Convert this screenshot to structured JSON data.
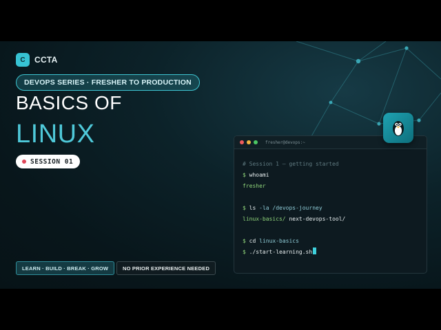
{
  "brand": {
    "logo_letter": "C",
    "name": "CCTA"
  },
  "series_pill": "DEVOPS SERIES · FRESHER TO PRODUCTION",
  "title": {
    "line1": "BASICS OF",
    "line2": "LINUX"
  },
  "session": "SESSION 01",
  "tags": {
    "learn": "LEARN · BUILD · BREAK · GROW",
    "prior": "NO PRIOR EXPERIENCE NEEDED"
  },
  "terminal": {
    "title": "fresher@devops:~",
    "comment": "# Session 1 — getting started",
    "prompt": "$",
    "cmd_whoami": "whoami",
    "out_whoami": "fresher",
    "cmd_ls": "ls",
    "cmd_ls_args": "-la /devops-journey",
    "out_ls_dir": "linux-basics/",
    "out_ls_plain": "next-devops-tool/",
    "cmd_cd": "cd",
    "cmd_cd_arg": "linux-basics",
    "cmd_run": "./start-learning.sh"
  },
  "badge_icon": "tux-icon",
  "colors": {
    "accent": "#4fc9d9",
    "background": "#08161b",
    "session_dot": "#e0475a",
    "prompt_green": "#8fd47a"
  }
}
